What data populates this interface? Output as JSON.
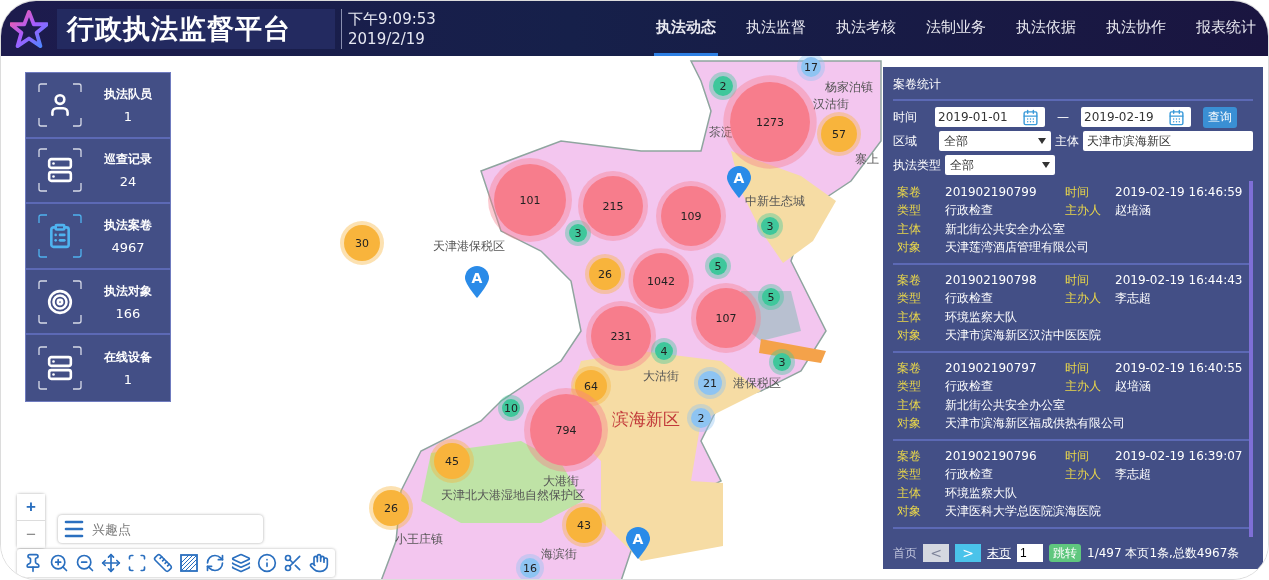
{
  "header": {
    "title": "行政执法监督平台",
    "time": "下午9:09:53",
    "date": "2019/2/19"
  },
  "nav": [
    {
      "label": "执法动态",
      "selected": true
    },
    {
      "label": "执法监督",
      "selected": false
    },
    {
      "label": "执法考核",
      "selected": false
    },
    {
      "label": "法制业务",
      "selected": false
    },
    {
      "label": "执法依据",
      "selected": false
    },
    {
      "label": "执法协作",
      "selected": false
    },
    {
      "label": "报表统计",
      "selected": false
    }
  ],
  "stats": [
    {
      "kind": "person",
      "label": "执法队员",
      "value": "1",
      "selected": false
    },
    {
      "kind": "server",
      "label": "巡查记录",
      "value": "24",
      "selected": false
    },
    {
      "kind": "clipboard",
      "label": "执法案卷",
      "value": "4967",
      "selected": true
    },
    {
      "kind": "target",
      "label": "执法对象",
      "value": "166",
      "selected": false
    },
    {
      "kind": "server",
      "label": "在线设备",
      "value": "1",
      "selected": false
    }
  ],
  "map": {
    "places": [
      {
        "kind": "town",
        "name": "杨家泊镇"
      },
      {
        "kind": "town",
        "name": "汉沽街"
      },
      {
        "kind": "town",
        "name": "寨上"
      },
      {
        "kind": "town",
        "name": "茶淀"
      },
      {
        "kind": "town",
        "name": "中新生态城"
      },
      {
        "kind": "town",
        "name": "天津港保税区"
      },
      {
        "kind": "town",
        "name": "大沽街"
      },
      {
        "kind": "town",
        "name": "港保税区"
      },
      {
        "kind": "district",
        "name": "滨海新区"
      },
      {
        "kind": "town",
        "name": "大港街"
      },
      {
        "kind": "town",
        "name": "天津北大港湿地自然保护区"
      },
      {
        "kind": "town",
        "name": "小王庄镇"
      },
      {
        "kind": "town",
        "name": "海滨街"
      }
    ],
    "clusters": [
      {
        "count": "17",
        "color": "#8ec4f2"
      },
      {
        "count": "2",
        "color": "#3fc79b"
      },
      {
        "count": "1273",
        "color": "#f77d8c"
      },
      {
        "count": "57",
        "color": "#f8b43c"
      },
      {
        "count": "101",
        "color": "#f77d8c"
      },
      {
        "count": "3",
        "color": "#3fc79b"
      },
      {
        "count": "215",
        "color": "#f77d8c"
      },
      {
        "count": "109",
        "color": "#f77d8c"
      },
      {
        "count": "3",
        "color": "#3fc79b"
      },
      {
        "count": "30",
        "color": "#f8b43c"
      },
      {
        "count": "26",
        "color": "#f8b43c"
      },
      {
        "count": "5",
        "color": "#3fc79b"
      },
      {
        "count": "1042",
        "color": "#f77d8c"
      },
      {
        "count": "5",
        "color": "#3fc79b"
      },
      {
        "count": "231",
        "color": "#f77d8c"
      },
      {
        "count": "107",
        "color": "#f77d8c"
      },
      {
        "count": "4",
        "color": "#3fc79b"
      },
      {
        "count": "64",
        "color": "#f8b43c"
      },
      {
        "count": "3",
        "color": "#3fc79b"
      },
      {
        "count": "21",
        "color": "#8ec4f2"
      },
      {
        "count": "10",
        "color": "#3fc79b"
      },
      {
        "count": "2",
        "color": "#8ec4f2"
      },
      {
        "count": "794",
        "color": "#f77d8c"
      },
      {
        "count": "45",
        "color": "#f8b43c"
      },
      {
        "count": "26",
        "color": "#f8b43c"
      },
      {
        "count": "43",
        "color": "#f8b43c"
      },
      {
        "count": "16",
        "color": "#8ec4f2"
      }
    ],
    "markers": [
      {
        "label": "A"
      },
      {
        "label": "A"
      },
      {
        "label": "A"
      }
    ],
    "zoom_in": "+",
    "zoom_out": "−",
    "search": {
      "placeholder": "兴趣点"
    },
    "tools": [
      {
        "kind": "pin"
      },
      {
        "kind": "zoom-in"
      },
      {
        "kind": "zoom-out"
      },
      {
        "kind": "move"
      },
      {
        "kind": "frame"
      },
      {
        "kind": "ruler"
      },
      {
        "kind": "hatch"
      },
      {
        "kind": "refresh"
      },
      {
        "kind": "layers"
      },
      {
        "kind": "info"
      },
      {
        "kind": "scissors"
      },
      {
        "kind": "hand"
      }
    ]
  },
  "cases": {
    "title": "案卷统计",
    "filters": {
      "time_label": "时间",
      "from": "2019-01-01",
      "separator": "—",
      "to": "2019-02-19",
      "query": "查询",
      "region_label": "区域",
      "region": "全部",
      "subject_label": "主体",
      "subject": "天津市滨海新区",
      "type_label": "执法类型",
      "type": "全部"
    },
    "records": [
      {
        "rows": [
          [
            {
              "label": "案卷",
              "value": "201902190799"
            },
            {
              "label": "时间",
              "value": "2019-02-19 16:46:59"
            }
          ],
          [
            {
              "label": "类型",
              "value": "行政检查"
            },
            {
              "label": "主办人",
              "value": "赵培涵"
            }
          ],
          [
            {
              "label": "主体",
              "value": "新北街公共安全办公室"
            }
          ],
          [
            {
              "label": "对象",
              "value": "天津莲湾酒店管理有限公司"
            }
          ]
        ]
      },
      {
        "rows": [
          [
            {
              "label": "案卷",
              "value": "201902190798"
            },
            {
              "label": "时间",
              "value": "2019-02-19 16:44:43"
            }
          ],
          [
            {
              "label": "类型",
              "value": "行政检查"
            },
            {
              "label": "主办人",
              "value": "李志超"
            }
          ],
          [
            {
              "label": "主体",
              "value": "环境监察大队"
            }
          ],
          [
            {
              "label": "对象",
              "value": "天津市滨海新区汉沽中医医院"
            }
          ]
        ]
      },
      {
        "rows": [
          [
            {
              "label": "案卷",
              "value": "201902190797"
            },
            {
              "label": "时间",
              "value": "2019-02-19 16:40:55"
            }
          ],
          [
            {
              "label": "类型",
              "value": "行政检查"
            },
            {
              "label": "主办人",
              "value": "赵培涵"
            }
          ],
          [
            {
              "label": "主体",
              "value": "新北街公共安全办公室"
            }
          ],
          [
            {
              "label": "对象",
              "value": "天津市滨海新区福成供热有限公司"
            }
          ]
        ]
      },
      {
        "rows": [
          [
            {
              "label": "案卷",
              "value": "201902190796"
            },
            {
              "label": "时间",
              "value": "2019-02-19 16:39:07"
            }
          ],
          [
            {
              "label": "类型",
              "value": "行政检查"
            },
            {
              "label": "主办人",
              "value": "李志超"
            }
          ],
          [
            {
              "label": "主体",
              "value": "环境监察大队"
            }
          ],
          [
            {
              "label": "对象",
              "value": "天津医科大学总医院滨海医院"
            }
          ]
        ]
      }
    ],
    "pagination": {
      "first": "首页",
      "prev": {
        "label": "<",
        "disabled": true
      },
      "next": {
        "label": ">",
        "disabled": false
      },
      "last": "末页",
      "page": "1",
      "jump": "跳转",
      "info": "1/497 本页1条,总数4967条"
    }
  }
}
